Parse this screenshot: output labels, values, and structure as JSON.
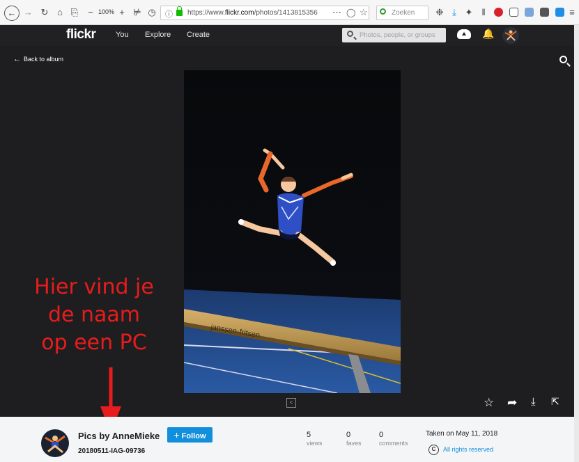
{
  "browser": {
    "zoom_label": "100%",
    "url_prefix": "https://www.",
    "url_domain": "flickr.com",
    "url_path": "/photos/1413815356",
    "search_placeholder": "Zoeken"
  },
  "header": {
    "logo": "flickr",
    "nav": [
      "You",
      "Explore",
      "Create"
    ],
    "search_placeholder": "Photos, people, or groups"
  },
  "viewer": {
    "back_label": "Back to album",
    "beam_brand": "janssen-fritsen"
  },
  "annotation": {
    "lines": [
      "Hier vind je",
      "de naam",
      "op een PC"
    ],
    "color": "#e81c1c"
  },
  "photo_info": {
    "owner": "Pics by AnneMieke",
    "follow_label": "Follow",
    "title": "20180511-IAG-09736",
    "stats": [
      {
        "value": "5",
        "label": "views"
      },
      {
        "value": "0",
        "label": "faves"
      },
      {
        "value": "0",
        "label": "comments"
      }
    ],
    "taken": "Taken on May 11, 2018",
    "license_icon": "C",
    "license": "All rights reserved"
  },
  "colors": {
    "header_bg": "#212124",
    "viewer_bg": "#1e1e20",
    "follow_blue": "#128fdc",
    "info_bg": "#f3f5f6"
  }
}
